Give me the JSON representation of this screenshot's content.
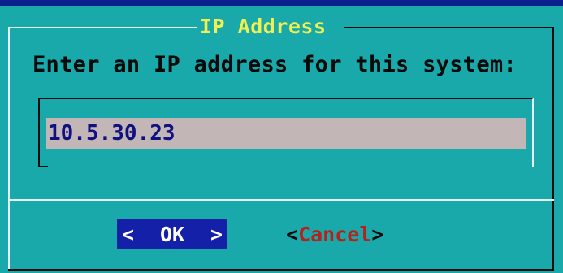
{
  "dialog": {
    "title": "IP Address",
    "prompt": "Enter an IP address for this system:",
    "input": {
      "value": "10.5.30.23",
      "placeholder": ""
    },
    "buttons": {
      "ok": {
        "left_bracket": "<",
        "label": "OK",
        "right_bracket": ">"
      },
      "cancel": {
        "left_bracket": "<",
        "hotkey": "C",
        "rest": "ancel",
        "right_bracket": ">"
      }
    }
  },
  "colors": {
    "screen_background": "#0b1f8f",
    "dialog_background": "#19a9ab",
    "title_text": "#f0f050",
    "input_background": "#c3b6b6",
    "input_text": "#101080",
    "selected_button_background": "#1520a8",
    "hotkey_text": "#b8201c"
  }
}
